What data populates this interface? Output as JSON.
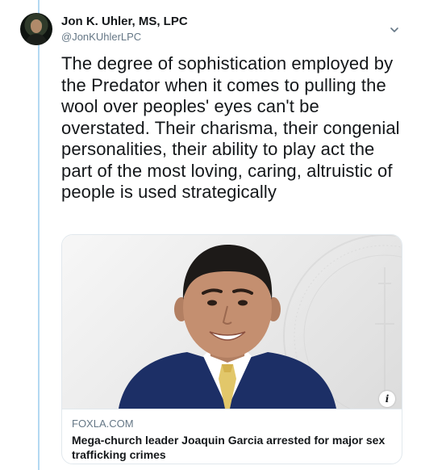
{
  "tweet": {
    "author": {
      "display_name": "Jon K. Uhler, MS, LPC",
      "handle": "@JonKUhlerLPC",
      "avatar_icon": "profile-photo"
    },
    "menu_icon": "chevron-down-icon",
    "text": "The degree of sophistication employed by the Predator when it comes to pulling the wool over peoples' eyes can't be overstated. Their charisma, their congenial personalities, their ability to play act the part of the most loving, caring, altruistic of people is used strategically",
    "card": {
      "domain": "FOXLA.COM",
      "title": "Mega-church leader Joaquin Garcia arrested for major sex trafficking crimes",
      "info_icon": "info-icon"
    }
  },
  "colors": {
    "thread_line": "#b3d9f2",
    "secondary_text": "#657786",
    "border": "#e1e8ed",
    "suit": "#1c2f66",
    "tie": "#e2c76a"
  }
}
